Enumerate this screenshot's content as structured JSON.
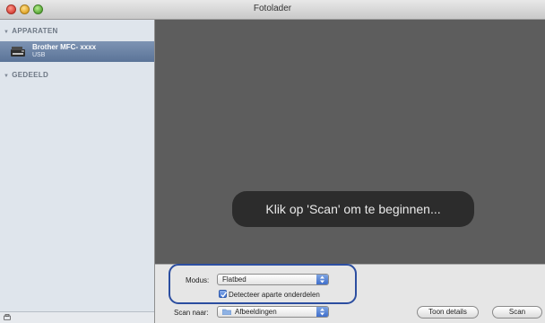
{
  "window": {
    "title": "Fotolader"
  },
  "sidebar": {
    "sections": [
      {
        "label": "APPARATEN"
      },
      {
        "label": "GEDEELD"
      }
    ],
    "devices": [
      {
        "name": "Brother MFC- xxxx",
        "connection": "USB",
        "selected": true
      }
    ]
  },
  "preview": {
    "message": "Klik op 'Scan' om te beginnen..."
  },
  "controls": {
    "mode_label": "Modus:",
    "mode_value": "Flatbed",
    "detect_label": "Detecteer aparte onderdelen",
    "detect_checked": true,
    "scan_to_label": "Scan naar:",
    "scan_to_value": "Afbeeldingen",
    "show_details_label": "Toon details",
    "scan_label": "Scan"
  },
  "colors": {
    "highlight": "#2c4ea0",
    "sidebar_bg": "#dfe5ec",
    "preview_bg": "#5d5d5d",
    "selection": "#5b7498"
  }
}
